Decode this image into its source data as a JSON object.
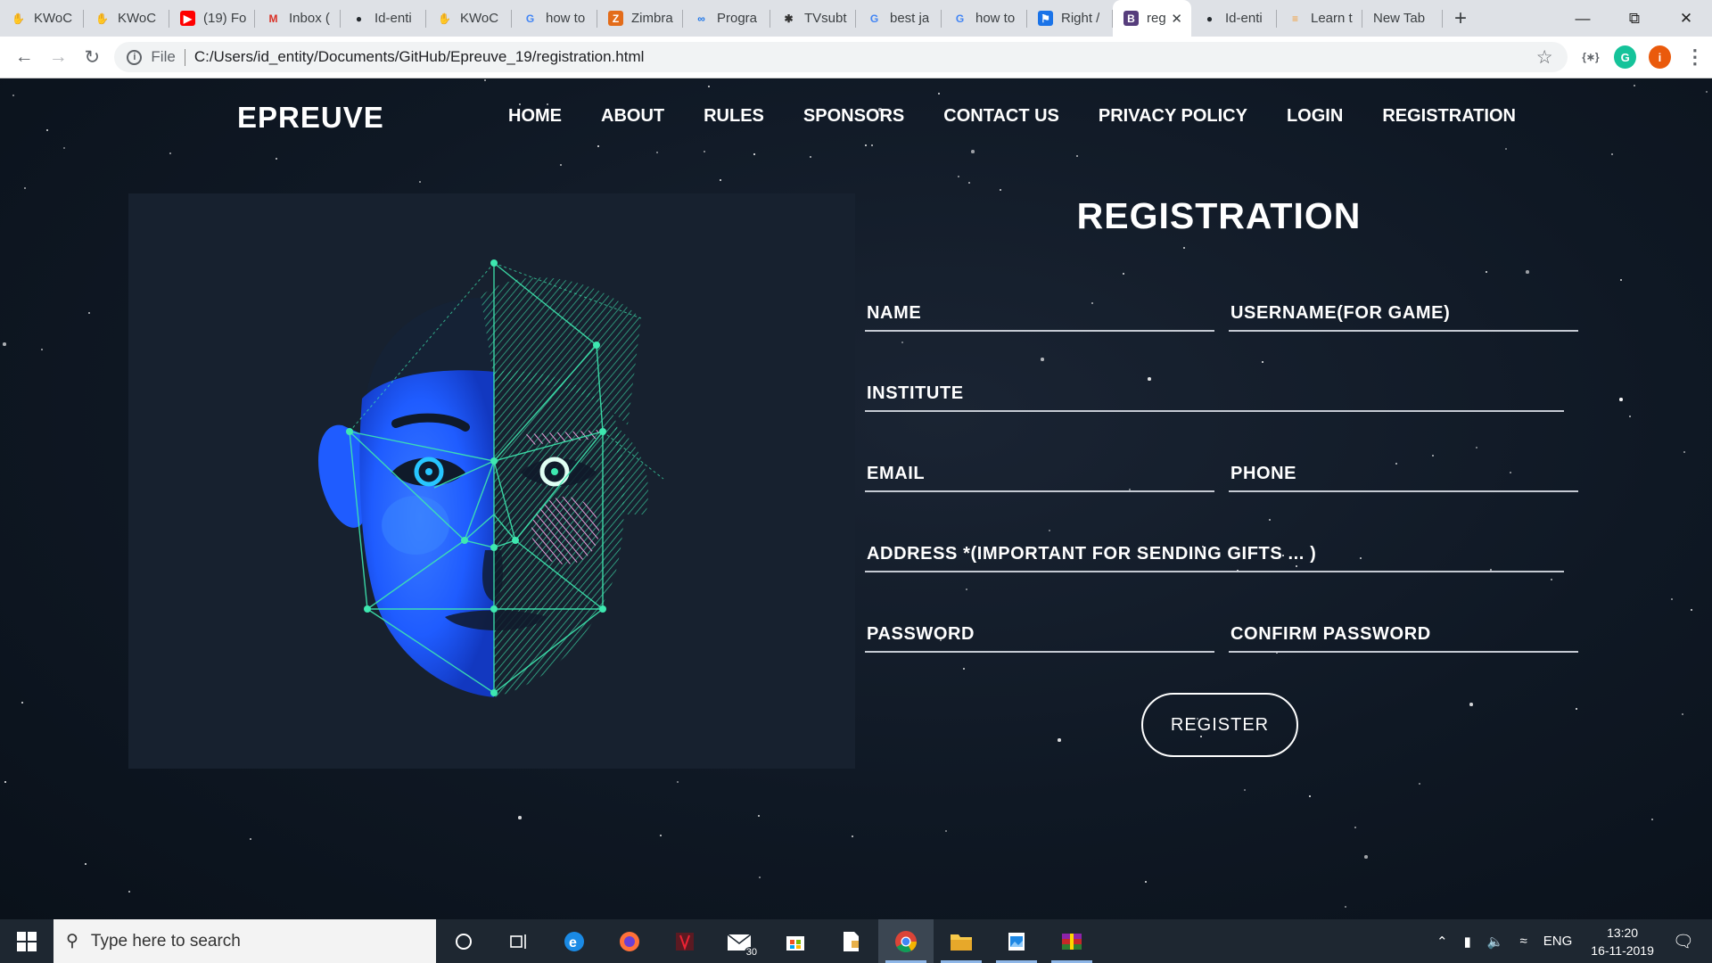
{
  "browser": {
    "tabs": [
      {
        "label": "KWoC",
        "icon": "hand-icon"
      },
      {
        "label": "KWoC",
        "icon": "hand-icon"
      },
      {
        "label": "(19) Fo",
        "icon": "youtube-icon"
      },
      {
        "label": "Inbox (",
        "icon": "gmail-icon"
      },
      {
        "label": "Id-enti",
        "icon": "github-icon"
      },
      {
        "label": "KWoC",
        "icon": "hand-icon"
      },
      {
        "label": "how to",
        "icon": "google-icon"
      },
      {
        "label": "Zimbra",
        "icon": "zimbra-icon"
      },
      {
        "label": "Progra",
        "icon": "infinity-icon"
      },
      {
        "label": "TVsubt",
        "icon": "tvsubs-icon"
      },
      {
        "label": "best ja",
        "icon": "google-icon"
      },
      {
        "label": "how to",
        "icon": "google-icon"
      },
      {
        "label": "Right /",
        "icon": "flag-icon"
      },
      {
        "label": "reg",
        "icon": "bootstrap-icon",
        "active": true
      },
      {
        "label": "Id-enti",
        "icon": "github-icon"
      },
      {
        "label": "Learn t",
        "icon": "learn-icon"
      },
      {
        "label": "New Tab",
        "icon": "none"
      }
    ],
    "address": {
      "scheme_label": "File",
      "url": "C:/Users/id_entity/Documents/GitHub/Epreuve_19/registration.html"
    },
    "extensions": [
      {
        "icon": "extension-bracket-icon",
        "label": "{∗}"
      },
      {
        "icon": "grammarly-icon",
        "label": "G"
      },
      {
        "icon": "profile-avatar-icon",
        "label": "i"
      }
    ]
  },
  "site": {
    "logo": "EPREUVE",
    "nav": [
      "HOME",
      "ABOUT",
      "RULES",
      "SPONSORS",
      "CONTACT US",
      "PRIVACY POLICY",
      "LOGIN",
      "REGISTRATION"
    ]
  },
  "form": {
    "title": "REGISTRATION",
    "fields": {
      "name": "NAME",
      "username": "USERNAME(FOR GAME)",
      "institute": "INSTITUTE",
      "email": "EMAIL",
      "phone": "PHONE",
      "address": "ADDRESS *(IMPORTANT FOR SENDING GIFTS ... )",
      "password": "PASSWORD",
      "confirm_password": "CONFIRM PASSWORD"
    },
    "submit": "REGISTER"
  },
  "taskbar": {
    "search_placeholder": "Type here to search",
    "mail_badge": "30",
    "language": "ENG",
    "time": "13:20",
    "date": "16-11-2019"
  },
  "colors": {
    "page_bg": "#0f1824",
    "face_blue": "#1f5cff",
    "mesh_green": "#3ee8b0",
    "accent_pink": "#e89bd8"
  }
}
